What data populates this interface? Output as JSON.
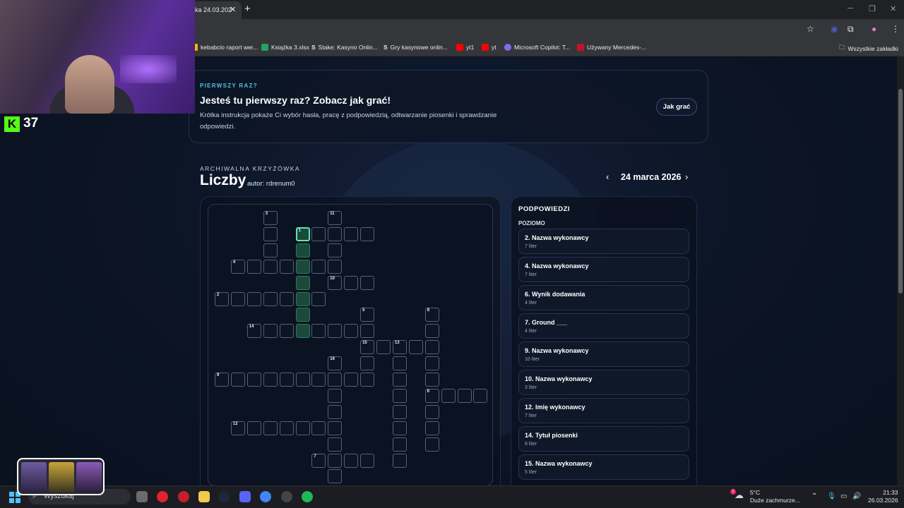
{
  "browser": {
    "tab_title": "ka 24.03.202",
    "new_tab": "+",
    "bookmarks": [
      {
        "label": "kebabcio raport wer...",
        "color": "#f4b400"
      },
      {
        "label": "Książka 3.xlsx",
        "color": "#21a366"
      },
      {
        "label": "Stake: Kasyno Onlin...",
        "color": "#3a3a3a"
      },
      {
        "label": "Gry kasynowe onlin...",
        "color": "#3a3a3a"
      },
      {
        "label": "yt1",
        "color": "#ff0000"
      },
      {
        "label": "yt",
        "color": "#ff0000"
      },
      {
        "label": "Microsoft Copilot: T...",
        "color": "#7f6cf0"
      },
      {
        "label": "Używany Mercedes-...",
        "color": "#c8102e"
      }
    ],
    "all_bookmarks": "Wszystkie zakładki"
  },
  "intro": {
    "kicker": "PIERWSZY RAZ?",
    "title": "Jesteś tu pierwszy raz? Zobacz jak grać!",
    "description": "Krótka instrukcja pokaże Ci wybór hasła, pracę z podpowiedzią, odtwarzanie piosenki i sprawdzanie odpowiedzi.",
    "button": "Jak grać"
  },
  "puzzle": {
    "kicker": "ARCHIWALNA KRZYŻÓWKA",
    "title": "Liczby",
    "author_label": "autor: rdrenum0",
    "date": "24 marca 2026",
    "prev": "‹",
    "next": "›"
  },
  "clues": {
    "title": "PODPOWIEDZI",
    "section": "POZIOMO",
    "items": [
      {
        "title": "2. Nazwa wykonawcy",
        "letters": "7 liter"
      },
      {
        "title": "4. Nazwa wykonawcy",
        "letters": "7 liter"
      },
      {
        "title": "6. Wynik dodawania",
        "letters": "4 liter"
      },
      {
        "title": "7. Ground ___",
        "letters": "4 liter"
      },
      {
        "title": "9. Nazwa wykonawcy",
        "letters": "10 liter"
      },
      {
        "title": "10. Nazwa wykonawcy",
        "letters": "3 liter"
      },
      {
        "title": "12. Imię wykonawcy",
        "letters": "7 liter"
      },
      {
        "title": "14. Tytuł piosenki",
        "letters": "8 liter"
      },
      {
        "title": "15. Nazwa wykonawcy",
        "letters": "5 liter"
      }
    ]
  },
  "stream": {
    "platform_icon": "K",
    "viewer_count": "37"
  },
  "taskbar": {
    "search": "Wyszukaj",
    "weather_temp": "5°C",
    "weather_desc": "Duże zachmurze...",
    "notification_count": "1",
    "time": "21:33",
    "date": "26.03.2026"
  },
  "colors": {
    "accent": "#4fc3dc",
    "highlight_cell": "#1b4a3b",
    "selected_border": "#5fe3b5",
    "page_bg": "#0b1220"
  }
}
